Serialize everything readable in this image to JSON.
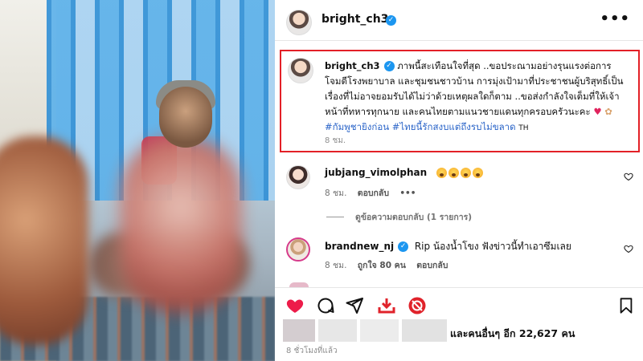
{
  "post": {
    "author": "bright_ch3",
    "more_label": "•••"
  },
  "caption": {
    "username": "bright_ch3",
    "text": "ภาพนี้สะเทือนใจที่สุด ..ขอประณามอย่างรุนแรงต่อการโจมตีโรงพยาบาล และชุมชนชาวบ้าน การมุ่งเป้ามาที่ประชาชนผู้บริสุทธิ์เป็นเรื่องที่ไม่อาจยอมรับได้ไม่ว่าด้วยเหตุผลใดก็ตาม ..ขอส่งกำลังใจเต็มที่ให้เจ้าหน้าที่ทหารทุกนาย และคนไทยตามแนวชายแดนทุกครอบครัวนะคะ",
    "hashtags": "#กัมพูชายิงก่อน #ไทยนี้รักสงบแต่ถึงรบไม่ขลาด",
    "translate": "TH",
    "time": "8 ชม."
  },
  "comments": [
    {
      "username": "jubjang_vimolphan",
      "text": "",
      "time": "8 ชม.",
      "reply_label": "ตอบกลับ",
      "emoji_count": 4
    },
    {
      "username": "brandnew_nj",
      "text": "Rip น้องน้ำโขง ฟังข่าวนี้ทำเอาซึมเลย",
      "time": "8 ชม.",
      "likes": "ถูกใจ 80 คน",
      "reply_label": "ตอบกลับ"
    }
  ],
  "view_replies": "ดูข้อความตอบกลับ (1 รายการ)",
  "likes_text": "และคนอื่นๆ อีก 22,627 คน",
  "posted_ago": "8 ชั่วโมงที่แล้ว",
  "icons": [
    "heart-icon",
    "comment-icon",
    "share-icon",
    "download-icon",
    "repost-icon",
    "bookmark-icon"
  ],
  "colors": {
    "highlight": "#e32027",
    "verified": "#1c96f0",
    "hashtag": "#2a64c8",
    "like": "#ed1c4a",
    "download": "#e0232b"
  }
}
